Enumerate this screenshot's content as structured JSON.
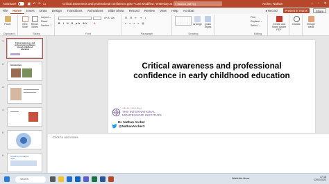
{
  "titlebar": {
    "autosave_label": "AutoSave",
    "autosave_state": "Off",
    "doc_title": "Critical awareness and professional confidence.pptx • Last Modified: Yesterday at 16:15 ⌄",
    "search_placeholder": "Search (Alt+Q)",
    "user_name": "Archer, Nathan",
    "qat_icons": [
      "save-icon",
      "undo-icon",
      "redo-icon",
      "present-icon",
      "more-icon"
    ]
  },
  "tabs": [
    "File",
    "Home",
    "Insert",
    "Draw",
    "Design",
    "Transitions",
    "Animations",
    "Slide Show",
    "Record",
    "Review",
    "View",
    "Help",
    "Acrobat"
  ],
  "active_tab": "Home",
  "right_actions": {
    "record": "● Record",
    "present": "Present in Teams",
    "share": "Share"
  },
  "ribbon": {
    "clipboard": {
      "paste": "Paste",
      "label": "Clipboard"
    },
    "slides": {
      "new_slide": "New Slide",
      "reuse": "Reuse Slides",
      "layout": "Layout ⌄",
      "reset": "Reset",
      "section": "Section ⌄",
      "label": "Slides"
    },
    "font": {
      "label": "Font"
    },
    "paragraph": {
      "label": "Paragraph"
    },
    "drawing": {
      "arrange": "Arrange",
      "quick_styles": "Quick Styles",
      "label": "Drawing"
    },
    "editing": {
      "find": "Find",
      "replace": "Replace ⌄",
      "select": "Select ⌄",
      "label": "Editing"
    },
    "adobe": {
      "button": "Create and Share Adobe PDF",
      "label": "Adobe Acrobat"
    },
    "voice": {
      "button": "Dictate",
      "label": "Voice"
    },
    "designer": {
      "button": "Design Ideas",
      "label": "Designer"
    }
  },
  "thumbnails": [
    {
      "num": "1",
      "title": "Critical awareness and professional confidence in early childhood education"
    },
    {
      "num": "2",
      "title": "Introductions"
    },
    {
      "num": "3",
      "title": ""
    },
    {
      "num": "4",
      "title": ""
    },
    {
      "num": "5",
      "title": ""
    },
    {
      "num": "6",
      "title": "Something more about rights"
    }
  ],
  "slide": {
    "title": "Critical awareness and professional confidence in early childhood education",
    "logo_small": "LEADING CONSULTANCY",
    "logo_big_1": "THE INTERNATIONAL",
    "logo_big_2": "MONTESSORI INSTITUTE",
    "author": "Dr. Nathan Archer",
    "twitter_handle": "@NathanArcher3"
  },
  "notes_placeholder": "Click to add notes",
  "status": {
    "slide_count": "Slide 1 of 23",
    "accessibility": "Accessibility: Investigate"
  },
  "taskbar": {
    "search_placeholder": "Search",
    "weather": "Watchlist ideas",
    "time": "17:18",
    "date": "12/01/2023"
  },
  "colors": {
    "accent": "#b7472a",
    "logo_purple": "#7a5a9e",
    "twitter_blue": "#1d9bf0"
  }
}
